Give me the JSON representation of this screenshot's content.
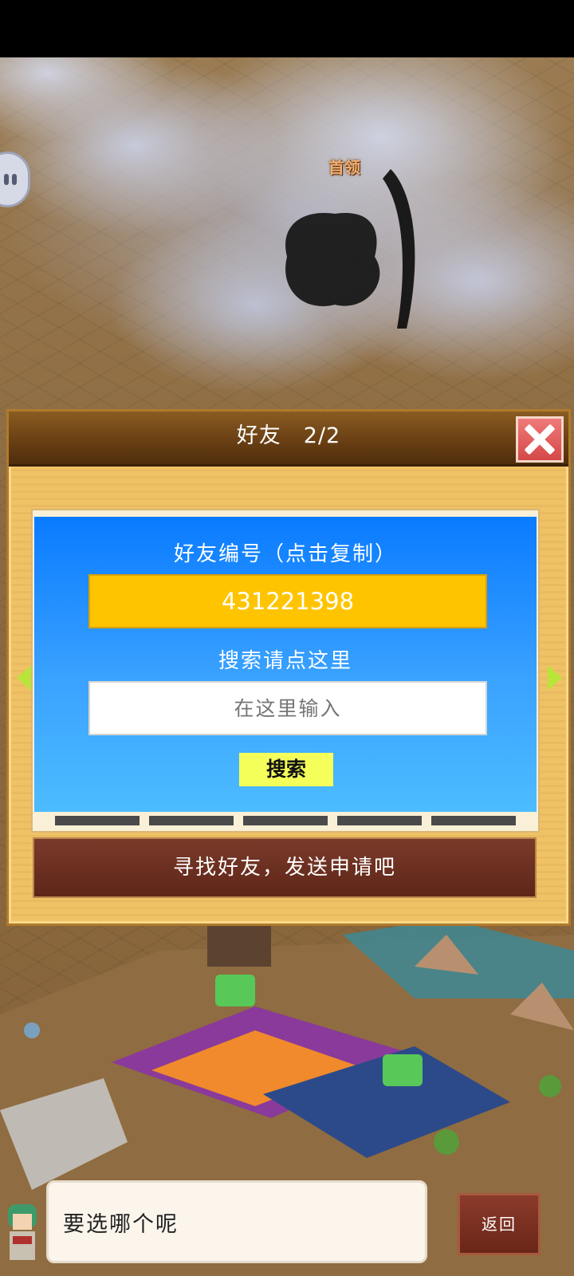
{
  "boss": {
    "label": "首领"
  },
  "dialog": {
    "title": "好友　2/2",
    "close_icon": "close-icon",
    "friend_id_label": "好友编号（点击复制）",
    "friend_id_value": "431221398",
    "search_label": "搜索请点这里",
    "search_placeholder": "在这里输入",
    "search_button": "搜索",
    "banner": "寻找好友，发送申请吧"
  },
  "footer": {
    "speech": "要选哪个呢",
    "back_button": "返回"
  },
  "colors": {
    "id_box": "#ffc400",
    "panel": "#2e95ff",
    "search_button": "#f4ff5a",
    "close_button": "#e05a5a",
    "nav_arrow": "#b9e43a"
  }
}
